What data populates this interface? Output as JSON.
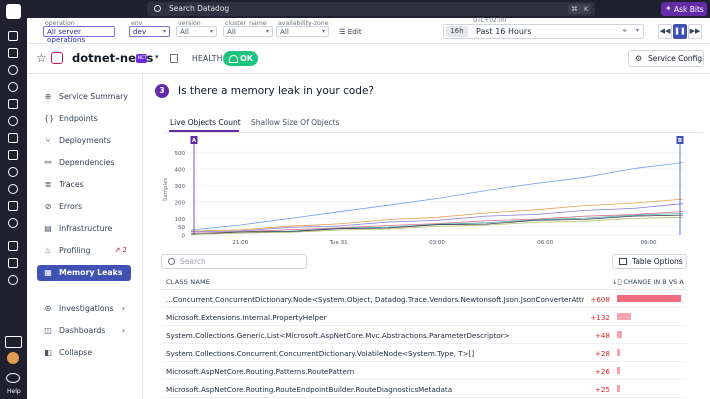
{
  "topbar": {
    "search_placeholder": "Search Datadog",
    "shortcut_cmd": "⌘",
    "shortcut_key": "K",
    "ask_bits": "Ask Bits"
  },
  "filters": {
    "operation_label": "operation",
    "operation_value": "All server operations",
    "env_label": "env",
    "env_value": "dev",
    "version_label": "version",
    "version_value": "All",
    "cluster_label": "cluster_name",
    "cluster_value": "All",
    "zone_label": "availability-zone",
    "zone_value": "All",
    "edit": "Edit",
    "utc": "UTC+02:00",
    "time_short": "16h",
    "time_range": "Past 16 Hours"
  },
  "service": {
    "name": "dotnet-news",
    "net_badge": ".NET",
    "health_label": "HEALTH",
    "health_status": "OK",
    "service_config": "Service Config"
  },
  "sidebar": {
    "items": [
      {
        "label": "Service Summary",
        "icon": "globe-icon"
      },
      {
        "label": "Endpoints",
        "icon": "braces-icon"
      },
      {
        "label": "Deployments",
        "icon": "branch-icon"
      },
      {
        "label": "Dependencies",
        "icon": "graph-icon"
      },
      {
        "label": "Traces",
        "icon": "traces-icon"
      },
      {
        "label": "Errors",
        "icon": "errors-icon"
      },
      {
        "label": "Infrastructure",
        "icon": "server-icon"
      },
      {
        "label": "Profiling",
        "icon": "flame-icon",
        "badge": "2"
      },
      {
        "label": "Memory Leaks",
        "icon": "memory-icon",
        "active": true
      },
      {
        "label": "Investigations",
        "icon": "investigations-icon"
      },
      {
        "label": "Dashboards",
        "icon": "dashboard-icon"
      },
      {
        "label": "Collapse",
        "icon": "collapse-icon"
      }
    ]
  },
  "main": {
    "step": "3",
    "question": "Is there a memory leak in your code?",
    "tabs": [
      "Live Objects Count",
      "Shallow Size Of Objects"
    ],
    "search_placeholder": "Search",
    "table_options": "Table Options",
    "col_class": "CLASS NAME",
    "col_change": "CHANGE IN B VS A"
  },
  "table_rows": [
    {
      "name": "...Concurrent.ConcurrentDictionary.Node<System.Object, Datadog.Trace.Vendors.Newtonsoft.Json.JsonConverterAttribute>",
      "change": "+608",
      "frac": 1.0
    },
    {
      "name": "Microsoft.Extensions.Internal.PropertyHelper",
      "change": "+132",
      "frac": 0.22
    },
    {
      "name": "System.Collections.Generic.List<Microsoft.AspNetCore.Mvc.Abstractions.ParameterDescriptor>",
      "change": "+48",
      "frac": 0.08
    },
    {
      "name": "System.Collections.Concurrent.ConcurrentDictionary.VolatileNode<System.Type, T>[]",
      "change": "+28",
      "frac": 0.05
    },
    {
      "name": "Microsoft.AspNetCore.Routing.Patterns.RoutePattern",
      "change": "+26",
      "frac": 0.045
    },
    {
      "name": "Microsoft.AspNetCore.Routing.RouteEndpointBuilder.RouteDiagnosticsMetadata",
      "change": "+25",
      "frac": 0.04
    }
  ],
  "chart_data": {
    "type": "line",
    "ylabel": "Samples",
    "ylim": [
      0,
      550
    ],
    "yticks": [
      0,
      50,
      100,
      200,
      300,
      400,
      500
    ],
    "x_ticks": [
      "21:00",
      "Tue 31",
      "03:00",
      "06:00",
      "09:00"
    ],
    "marker_a": "A",
    "marker_b": "B",
    "x": [
      0,
      1,
      2,
      3,
      4,
      5,
      6,
      7,
      8,
      9,
      10
    ],
    "series": [
      {
        "color": "#6f9ff8",
        "values": [
          30,
          60,
          100,
          140,
          180,
          220,
          270,
          310,
          350,
          400,
          440
        ]
      },
      {
        "color": "#e6a050",
        "values": [
          20,
          35,
          50,
          70,
          90,
          110,
          130,
          155,
          175,
          195,
          215
        ]
      },
      {
        "color": "#8a78d8",
        "values": [
          15,
          28,
          42,
          58,
          75,
          92,
          110,
          128,
          145,
          165,
          185
        ]
      },
      {
        "color": "#e26d8d",
        "values": [
          10,
          20,
          32,
          44,
          56,
          70,
          84,
          98,
          112,
          126,
          140
        ]
      },
      {
        "color": "#4fb6a8",
        "values": [
          8,
          16,
          26,
          38,
          50,
          62,
          76,
          90,
          104,
          118,
          132
        ]
      },
      {
        "color": "#3f3f58",
        "values": [
          6,
          14,
          24,
          34,
          46,
          58,
          70,
          84,
          98,
          110,
          124
        ]
      },
      {
        "color": "#b7c36a",
        "values": [
          4,
          10,
          18,
          28,
          38,
          50,
          62,
          74,
          86,
          98,
          110
        ]
      }
    ]
  }
}
